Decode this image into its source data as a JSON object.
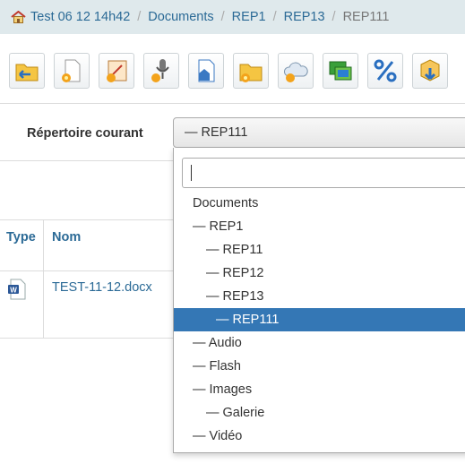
{
  "breadcrumb": {
    "items": [
      "Test 06 12 14h42",
      "Documents",
      "REP1",
      "REP13"
    ],
    "current": "REP111"
  },
  "toolbar": {
    "tools": [
      {
        "icon": "folder-up-icon"
      },
      {
        "icon": "new-document-icon"
      },
      {
        "icon": "new-drawing-icon"
      },
      {
        "icon": "audio-record-icon"
      },
      {
        "icon": "home-document-icon"
      },
      {
        "icon": "new-folder-icon"
      },
      {
        "icon": "cloud-icon"
      },
      {
        "icon": "images-icon"
      },
      {
        "icon": "quota-percent-icon"
      },
      {
        "icon": "download-box-icon"
      }
    ]
  },
  "current_directory": {
    "label": "Répertoire courant",
    "value": "— REP111"
  },
  "table": {
    "columns": [
      "Type",
      "Nom"
    ],
    "rows": [
      {
        "type_icon": "word-document-icon",
        "name": "TEST-11-12.docx"
      }
    ]
  },
  "dropdown": {
    "search_value": "",
    "options": [
      {
        "label": "Documents",
        "depth": 0,
        "selected": false
      },
      {
        "label": "— REP1",
        "depth": 0,
        "selected": false
      },
      {
        "label": "— REP11",
        "depth": 1,
        "selected": false
      },
      {
        "label": "— REP12",
        "depth": 1,
        "selected": false
      },
      {
        "label": "— REP13",
        "depth": 1,
        "selected": false
      },
      {
        "label": "— REP111",
        "depth": 2,
        "selected": true
      },
      {
        "label": "— Audio",
        "depth": 0,
        "selected": false
      },
      {
        "label": "— Flash",
        "depth": 0,
        "selected": false
      },
      {
        "label": "— Images",
        "depth": 0,
        "selected": false
      },
      {
        "label": "— Galerie",
        "depth": 1,
        "selected": false
      },
      {
        "label": "— Vidéo",
        "depth": 0,
        "selected": false
      }
    ]
  },
  "colors": {
    "breadcrumb_bg": "#dfe9ec",
    "link": "#2b6a96",
    "selected_option": "#3477b5"
  }
}
